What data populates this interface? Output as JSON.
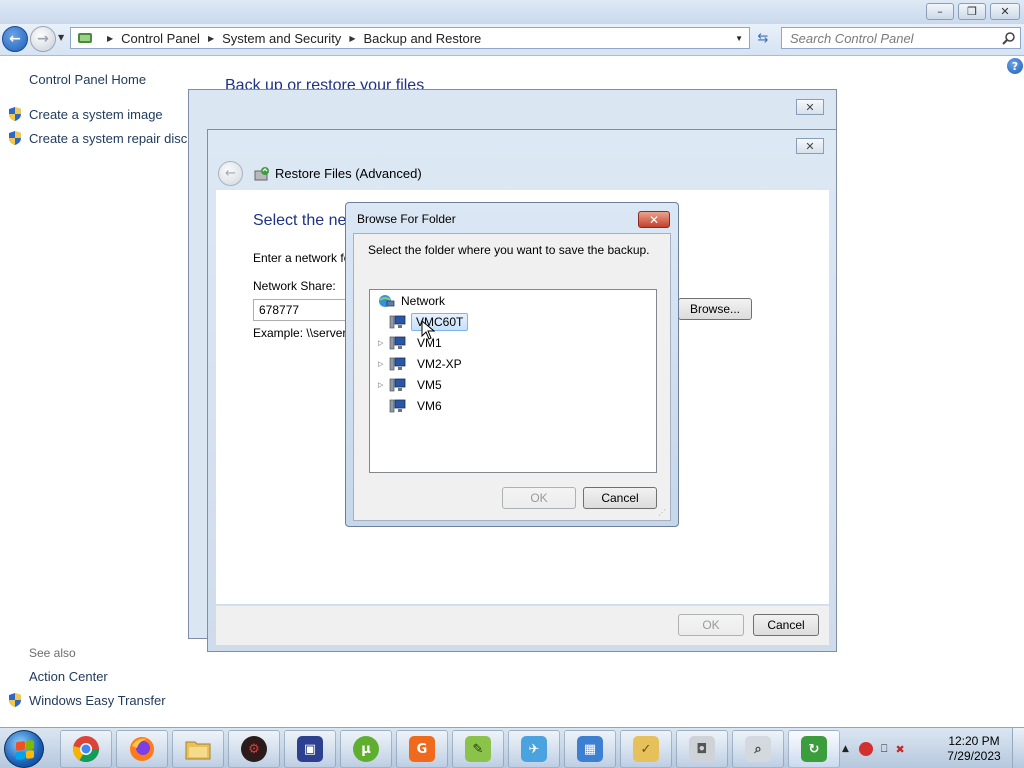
{
  "explorer": {
    "breadcrumb": [
      "Control Panel",
      "System and Security",
      "Backup and Restore"
    ],
    "search_placeholder": "Search Control Panel",
    "content_title": "Back up or restore your files",
    "sidebar": {
      "home": "Control Panel Home",
      "links": [
        "Create a system image",
        "Create a system repair disc"
      ],
      "see_also_label": "See also",
      "see_also": [
        "Action Center",
        "Windows Easy Transfer"
      ]
    }
  },
  "restore_window": {
    "title": "Restore Files (Advanced)",
    "heading": "Select the net",
    "instruction": "Enter a network fo",
    "share_label": "Network Share:",
    "share_value": "678777",
    "example": "Example: \\\\server",
    "browse_label": "Browse...",
    "ok_label": "OK",
    "cancel_label": "Cancel"
  },
  "browse_dialog": {
    "title": "Browse For Folder",
    "prompt": "Select the folder where you want to save the backup.",
    "tree": {
      "root": "Network",
      "items": [
        {
          "label": "VMC60T",
          "expandable": false,
          "selected": true
        },
        {
          "label": "VM1",
          "expandable": true,
          "selected": false
        },
        {
          "label": "VM2-XP",
          "expandable": true,
          "selected": false
        },
        {
          "label": "VM5",
          "expandable": true,
          "selected": false
        },
        {
          "label": "VM6",
          "expandable": false,
          "selected": false
        }
      ]
    },
    "ok_label": "OK",
    "cancel_label": "Cancel"
  },
  "taskbar": {
    "apps": [
      "Google Chrome",
      "Firefox",
      "Windows Explorer",
      "Process Hacker",
      "Remote Desktop",
      "uTorrent",
      "PDF Editor",
      "Notepad++",
      "Email",
      "Control Panel",
      "Folder",
      "Mouse",
      "Search",
      "Backup"
    ],
    "clock_time": "12:20 PM",
    "clock_date": "7/29/2023"
  },
  "colors": {
    "heading_blue": "#1e3287",
    "link_blue": "#1e395b",
    "taskbar": "#c6d6e8"
  }
}
